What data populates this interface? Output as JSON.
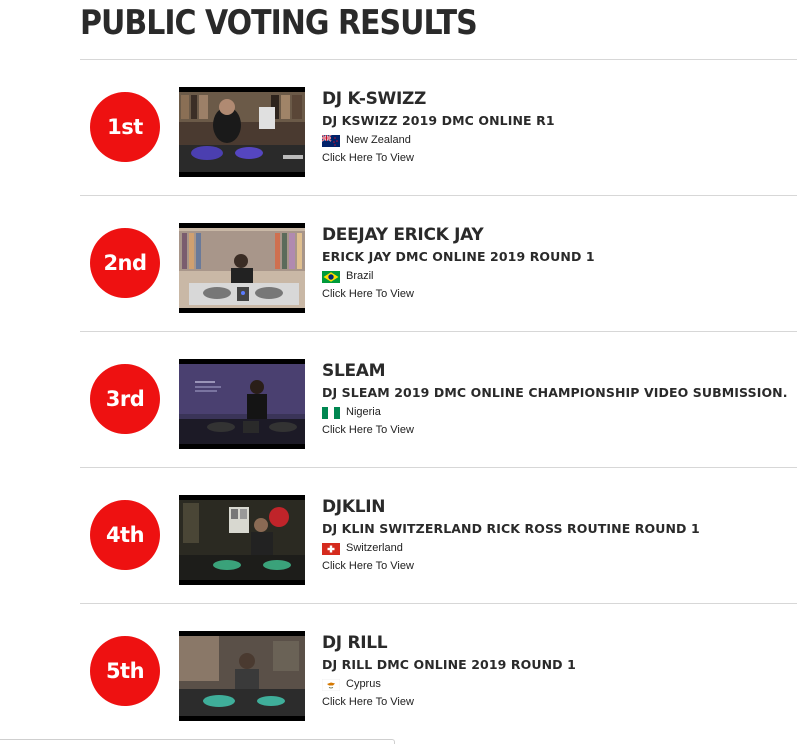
{
  "page": {
    "title": "PUBLIC VOTING RESULTS"
  },
  "colors": {
    "badge": "#ee1111",
    "divider": "#d7d7d7"
  },
  "results": [
    {
      "rank": "1st",
      "name": "DJ K-SWIZZ",
      "video_title": "DJ KSWIZZ 2019 DMC ONLINE R1",
      "country": "New Zealand",
      "flag_icon": "new-zealand-flag-icon",
      "link": "Click Here To View"
    },
    {
      "rank": "2nd",
      "name": "DEEJAY ERICK JAY",
      "video_title": "ERICK JAY DMC ONLINE 2019 ROUND 1",
      "country": "Brazil",
      "flag_icon": "brazil-flag-icon",
      "link": "Click Here To View"
    },
    {
      "rank": "3rd",
      "name": "SLEAM",
      "video_title": "DJ SLEAM 2019 DMC ONLINE CHAMPIONSHIP VIDEO SUBMISSION.",
      "country": "Nigeria",
      "flag_icon": "nigeria-flag-icon",
      "link": "Click Here To View"
    },
    {
      "rank": "4th",
      "name": "DJKLIN",
      "video_title": "DJ KLIN SWITZERLAND RICK ROSS ROUTINE ROUND 1",
      "country": "Switzerland",
      "flag_icon": "switzerland-flag-icon",
      "link": "Click Here To View"
    },
    {
      "rank": "5th",
      "name": "DJ RILL",
      "video_title": "DJ RILL DMC ONLINE 2019 ROUND 1",
      "country": "Cyprus",
      "flag_icon": "cyprus-flag-icon",
      "link": "Click Here To View"
    }
  ]
}
